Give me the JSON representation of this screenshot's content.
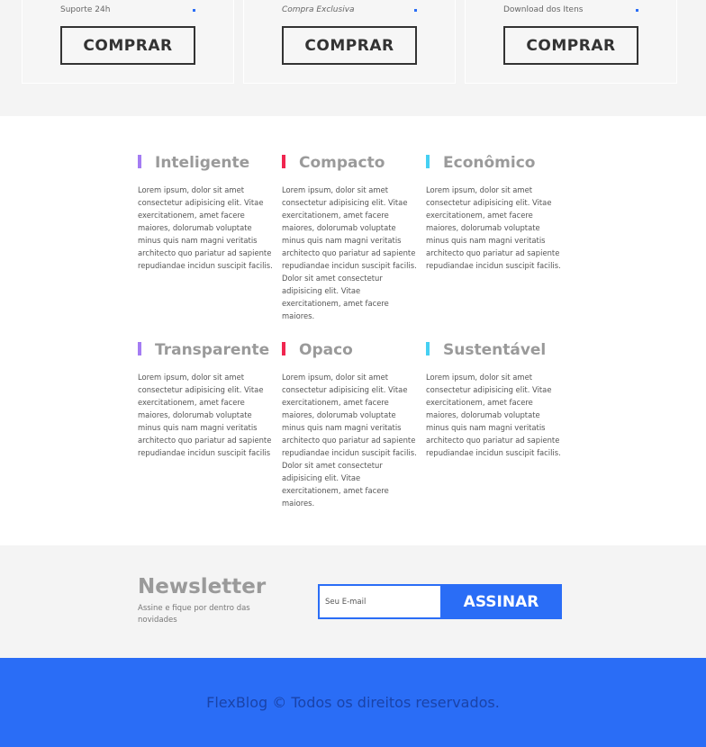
{
  "pricing": {
    "plans": [
      {
        "feature": "Suporte 24h",
        "button": "COMPRAR"
      },
      {
        "feature": "Compra Exclusiva",
        "button": "COMPRAR"
      },
      {
        "feature": "Download dos Itens",
        "button": "COMPRAR"
      }
    ]
  },
  "features": [
    {
      "title": "Inteligente",
      "color": "#a47cf3",
      "text": "Lorem ipsum, dolor sit amet consectetur adipisicing elit. Vitae exercitationem, amet facere maiores, dolorumab voluptate minus quis nam magni veritatis architecto quo pariatur ad sapiente repudiandae incidun suscipit facilis."
    },
    {
      "title": "Compacto",
      "color": "#f0254f",
      "text": "Lorem ipsum, dolor sit amet consectetur adipisicing elit. Vitae exercitationem, amet facere maiores, dolorumab voluptate minus quis nam magni veritatis architecto quo pariatur ad sapiente repudiandae incidun suscipit facilis. Dolor sit amet consectetur adipisicing elit. Vitae exercitationem, amet facere maiores."
    },
    {
      "title": "Econômico",
      "color": "#45d0f3",
      "text": "Lorem ipsum, dolor sit amet consectetur adipisicing elit. Vitae exercitationem, amet facere maiores, dolorumab voluptate minus quis nam magni veritatis architecto quo pariatur ad sapiente repudiandae incidun suscipit facilis."
    },
    {
      "title": "Transparente",
      "color": "#a47cf3",
      "text": "Lorem ipsum, dolor sit amet consectetur adipisicing elit. Vitae exercitationem, amet facere maiores, dolorumab voluptate minus quis nam magni veritatis architecto quo pariatur ad sapiente repudiandae incidun suscipit facilis"
    },
    {
      "title": "Opaco",
      "color": "#f0254f",
      "text": "Lorem ipsum, dolor sit amet consectetur adipisicing elit. Vitae exercitationem, amet facere maiores, dolorumab voluptate minus quis nam magni veritatis architecto quo pariatur ad sapiente repudiandae incidun suscipit facilis. Dolor sit amet consectetur adipisicing elit. Vitae exercitationem, amet facere maiores."
    },
    {
      "title": "Sustentável",
      "color": "#45d0f3",
      "text": "Lorem ipsum, dolor sit amet consectetur adipisicing elit. Vitae exercitationem, amet facere maiores, dolorumab voluptate minus quis nam magni veritatis architecto quo pariatur ad sapiente repudiandae incidun suscipit facilis."
    }
  ],
  "newsletter": {
    "title": "Newsletter",
    "subtitle": "Assine e fique por dentro das novidades",
    "placeholder": "Seu E-mail",
    "button": "ASSINAR"
  },
  "footer": {
    "text": "FlexBlog © Todos os direitos reservados."
  },
  "colors": {
    "accent": "#2a6df6",
    "purple": "#a47cf3",
    "red": "#f0254f",
    "cyan": "#45d0f3"
  }
}
